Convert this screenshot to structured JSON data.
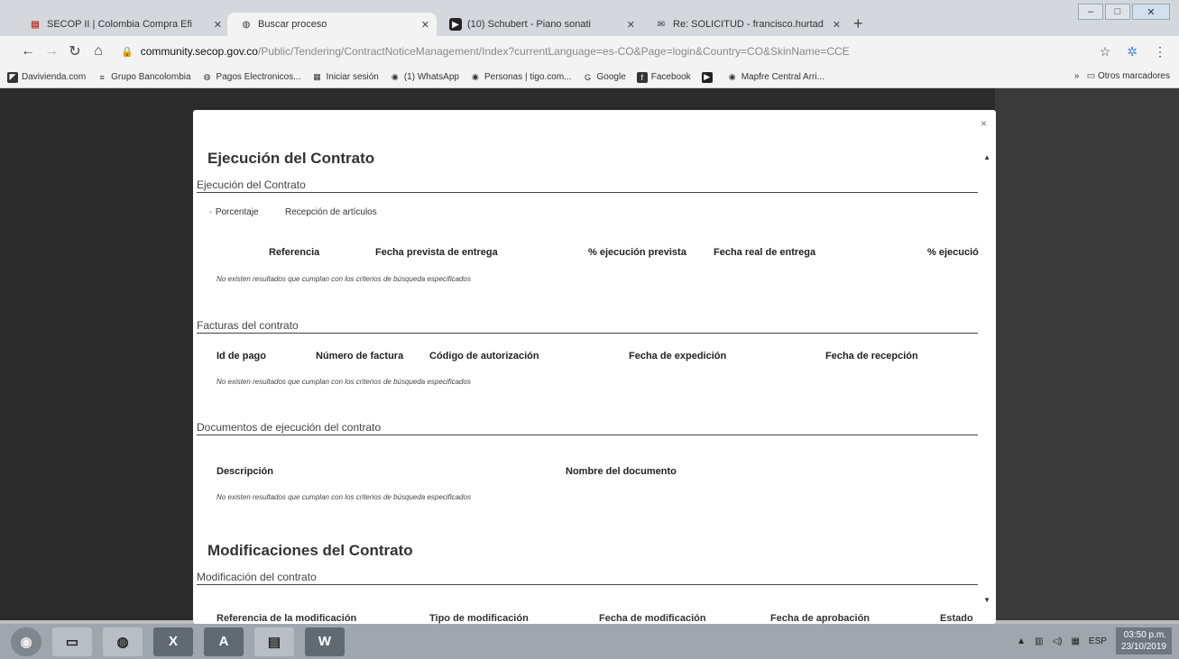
{
  "browser": {
    "tabs": [
      {
        "title": "SECOP II | Colombia Compra Efi",
        "favicon": "secop-icon",
        "active": false
      },
      {
        "title": "Buscar proceso",
        "favicon": "globe-icon",
        "active": true
      },
      {
        "title": "(10) Schubert - Piano sonati",
        "favicon": "youtube-icon",
        "active": false
      },
      {
        "title": "Re: SOLICITUD - francisco.hurtad",
        "favicon": "gmail-icon",
        "active": false
      }
    ],
    "url_host": "community.secop.gov.co",
    "url_path": "/Public/Tendering/ContractNoticeManagement/Index?currentLanguage=es-CO&Page=login&Country=CO&SkinName=CCE",
    "bookmarks": [
      {
        "label": "Davivienda.com",
        "icon": "davivienda-icon"
      },
      {
        "label": "Grupo Bancolombia",
        "icon": "bancolombia-icon"
      },
      {
        "label": "Pagos Electronicos...",
        "icon": "globe-icon"
      },
      {
        "label": "Iniciar sesión",
        "icon": "microsoft-icon"
      },
      {
        "label": "(1) WhatsApp",
        "icon": "whatsapp-icon"
      },
      {
        "label": "Personas | tigo.com...",
        "icon": "tigo-icon"
      },
      {
        "label": "Google",
        "icon": "google-icon"
      },
      {
        "label": "Facebook",
        "icon": "facebook-icon"
      },
      {
        "label": "",
        "icon": "youtube-icon"
      },
      {
        "label": "Mapfre Central Arri...",
        "icon": "mapfre-icon"
      }
    ],
    "bookmarks_more": "»",
    "other_bookmarks": "Otros marcadores"
  },
  "modal": {
    "close_label": "×",
    "execution": {
      "title": "Ejecución del Contrato",
      "subtitle": "Ejecución del Contrato",
      "radio_options": [
        "Porcentaje",
        "Recepción de artículos"
      ],
      "columns": [
        "Referencia",
        "Fecha prevista de entrega",
        "% ejecución prevista",
        "Fecha real de entrega",
        "% ejecució"
      ],
      "empty_message": "No existen resultados que cumplan con los criterios de búsqueda especificados"
    },
    "invoices": {
      "subtitle": "Facturas del contrato",
      "columns": [
        "Id de pago",
        "Número de factura",
        "Código de autorización",
        "Fecha de expedición",
        "Fecha de recepción"
      ],
      "empty_message": "No existen resultados que cumplan con los criterios de búsqueda especificados"
    },
    "documents": {
      "subtitle": "Documentos de ejecución del contrato",
      "columns": [
        "Descripción",
        "Nombre del documento"
      ],
      "empty_message": "No existen resultados que cumplan con los criterios de búsqueda especificados"
    },
    "modifications": {
      "title": "Modificaciones del Contrato",
      "subtitle": "Modificación del contrato",
      "partial_columns": [
        "Referencia de la modificación",
        "Tipo de modificación",
        "Fecha de modificación",
        "Fecha de aprobación",
        "Estado"
      ]
    }
  },
  "taskbar": {
    "apps": [
      "start-button",
      "file-explorer",
      "chrome",
      "excel",
      "acrobat",
      "notepad",
      "word"
    ],
    "language": "ESP",
    "time": "03:50 p.m.",
    "date": "23/10/2019"
  }
}
